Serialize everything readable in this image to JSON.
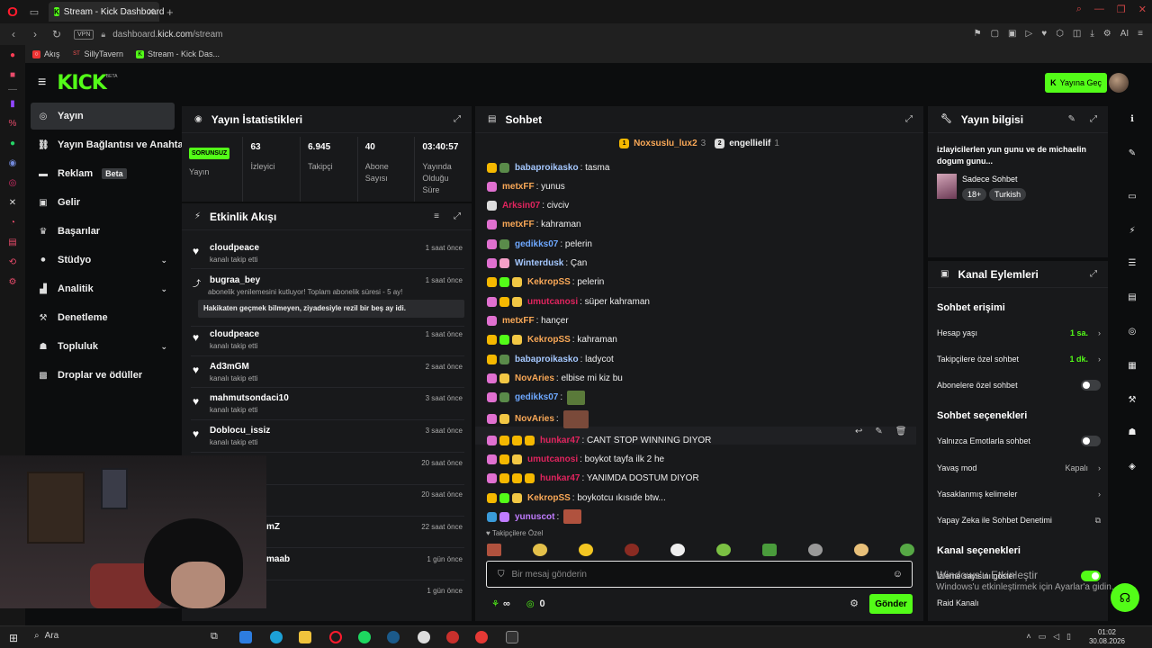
{
  "browser": {
    "tab_title": "Stream - Kick Dashboard",
    "url_prefix": "dashboard.",
    "url_domain": "kick.com",
    "url_path": "/stream",
    "vpn": "VPN",
    "bookmarks": [
      "Akış",
      "SillyTavern",
      "Stream - Kick Das..."
    ],
    "ai_label": "AI"
  },
  "header": {
    "logo": "KICK",
    "beta": "BETA",
    "go_live": "Yayına Geç"
  },
  "nav": {
    "items": [
      {
        "label": "Yayın",
        "icon": "play-circle-icon"
      },
      {
        "label": "Yayın Bağlantısı ve Anahtar",
        "icon": "link-icon"
      },
      {
        "label": "Reklam",
        "icon": "ad-icon"
      },
      {
        "label": "Gelir",
        "icon": "money-icon"
      },
      {
        "label": "Başarılar",
        "icon": "trophy-icon"
      },
      {
        "label": "Stüdyo",
        "icon": "studio-icon"
      },
      {
        "label": "Analitik",
        "icon": "chart-icon"
      },
      {
        "label": "Denetleme",
        "icon": "hammer-icon"
      },
      {
        "label": "Topluluk",
        "icon": "people-icon"
      },
      {
        "label": "Droplar ve ödüller",
        "icon": "gift-icon"
      }
    ],
    "beta_badge": "Beta"
  },
  "stats": {
    "title": "Yayın İstatistikleri",
    "status_badge": "SORUNSUZ",
    "status_label": "Yayın",
    "viewers": "63",
    "viewers_label": "İzleyici",
    "followers": "6.945",
    "followers_label": "Takipçi",
    "subs": "40",
    "subs_label": "Abone Sayısı",
    "uptime": "03:40:57",
    "uptime_label": "Yayında Olduğu Süre"
  },
  "activity": {
    "title": "Etkinlik Akışı",
    "items": [
      {
        "name": "cloudpeace",
        "sub": "kanalı takip etti",
        "time": "1 saat önce"
      },
      {
        "name": "bugraa_bey",
        "sub": "abonelik yenilemesini kutluyor! Toplam abonelik süresi - 5 ay!",
        "time": "1 saat önce",
        "message": "Hakikaten geçmek bilmeyen, ziyadesiyle rezil bir beş ay idi."
      },
      {
        "name": "cloudpeace",
        "sub": "kanalı takip etti",
        "time": "1 saat önce"
      },
      {
        "name": "Ad3mGM",
        "sub": "kanalı takip etti",
        "time": "2 saat önce"
      },
      {
        "name": "mahmutsondaci10",
        "sub": "kanalı takip etti",
        "time": "3 saat önce"
      },
      {
        "name": "Doblocu_issiz",
        "sub": "kanalı takip etti",
        "time": "3 saat önce"
      },
      {
        "name": "",
        "sub": "",
        "time": "20 saat önce"
      },
      {
        "name": "",
        "sub": "",
        "time": "20 saat önce"
      },
      {
        "name": "mZ",
        "sub": "",
        "time": "22 saat önce"
      },
      {
        "name": "maab",
        "sub": "",
        "time": "1 gün önce"
      },
      {
        "name": "",
        "sub": "",
        "time": "1 gün önce"
      }
    ]
  },
  "chat": {
    "title": "Sohbet",
    "pinned": [
      {
        "name": "Noxsuslu_lux2",
        "count": "3"
      },
      {
        "name": "engellielif",
        "count": "1"
      }
    ],
    "messages": [
      {
        "user": "babaproikasko",
        "text": ": tasma",
        "color": "#a5c8ff"
      },
      {
        "user": "metxFF",
        "text": ": yunus",
        "color": "#f9a857"
      },
      {
        "user": "Arksin07",
        "text": ": civciv",
        "color": "#e0245e"
      },
      {
        "user": "metxFF",
        "text": ": kahraman",
        "color": "#f9a857"
      },
      {
        "user": "gedikks07",
        "text": ": pelerin",
        "color": "#6ea8ff"
      },
      {
        "user": "Winterdusk",
        "text": ": Çan",
        "color": "#a5c8ff"
      },
      {
        "user": "KekropSS",
        "text": ": pelerin",
        "color": "#f9a857"
      },
      {
        "user": "umutcanosi",
        "text": ": süper kahraman",
        "color": "#e0245e"
      },
      {
        "user": "metxFF",
        "text": ": hançer",
        "color": "#f9a857"
      },
      {
        "user": "KekropSS",
        "text": ": kahraman",
        "color": "#f9a857"
      },
      {
        "user": "babaproikasko",
        "text": ": ladycot",
        "color": "#a5c8ff"
      },
      {
        "user": "NovAries",
        "text": ": elbise mi kiz bu",
        "color": "#f9a857"
      },
      {
        "user": "gedikks07",
        "text": ":",
        "color": "#6ea8ff"
      },
      {
        "user": "NovAries",
        "text": ":",
        "color": "#f9a857"
      },
      {
        "user": "hunkar47",
        "text": ": CANT STOP WINNING DIYOR",
        "color": "#e0245e"
      },
      {
        "user": "umutcanosi",
        "text": ": boykot tayfa ilk 2 he",
        "color": "#e0245e"
      },
      {
        "user": "hunkar47",
        "text": ": YANIMDA DOSTUM DIYOR",
        "color": "#e0245e"
      },
      {
        "user": "KekropSS",
        "text": ": boykotcu ıkısıde btw...",
        "color": "#f9a857"
      },
      {
        "user": "yunuscot",
        "text": ":",
        "color": "#c07cff"
      }
    ],
    "followers_only": "Takipçilere Özel",
    "placeholder": "Bir mesaj gönderin",
    "points_symbol": "∞",
    "count": "0",
    "send": "Gönder"
  },
  "stream_info": {
    "title": "Yayın bilgisi",
    "stream_title": "izlayicilerlen yun gunu ve de michaelin dogum gunu...",
    "category": "Sadece Sohbet",
    "tags": [
      "18+",
      "Turkish"
    ]
  },
  "channel_actions": {
    "title": "Kanal Eylemleri",
    "chat_access": "Sohbet erişimi",
    "account_age": "Hesap yaşı",
    "account_age_value": "1 sa.",
    "followers_chat": "Takipçilere özel sohbet",
    "followers_chat_value": "1 dk.",
    "subs_chat": "Abonelere özel sohbet",
    "chat_options": "Sohbet seçenekleri",
    "emote_only": "Yalnızca Emotlarla sohbet",
    "slow_mode": "Yavaş mod",
    "slow_mode_value": "Kapalı",
    "banned_words": "Yasaklanmış kelimeler",
    "ai_moderation": "Yapay Zeka ile Sohbet Denetimi",
    "channel_options": "Kanal seçenekleri",
    "show_viewers": "İzleme sayısını göster",
    "raid": "Raid Kanalı"
  },
  "windows": {
    "watermark_title": "Windows'u Etkinleştir",
    "watermark_sub": "Windows'u etkinleştirmek için Ayarlar'a gidin.",
    "search": "Ara",
    "time": "01:02",
    "date": "30.08.2026"
  },
  "colors": {
    "accent": "#53fc18",
    "panel": "#18191b",
    "background": "#0c0d0e"
  }
}
